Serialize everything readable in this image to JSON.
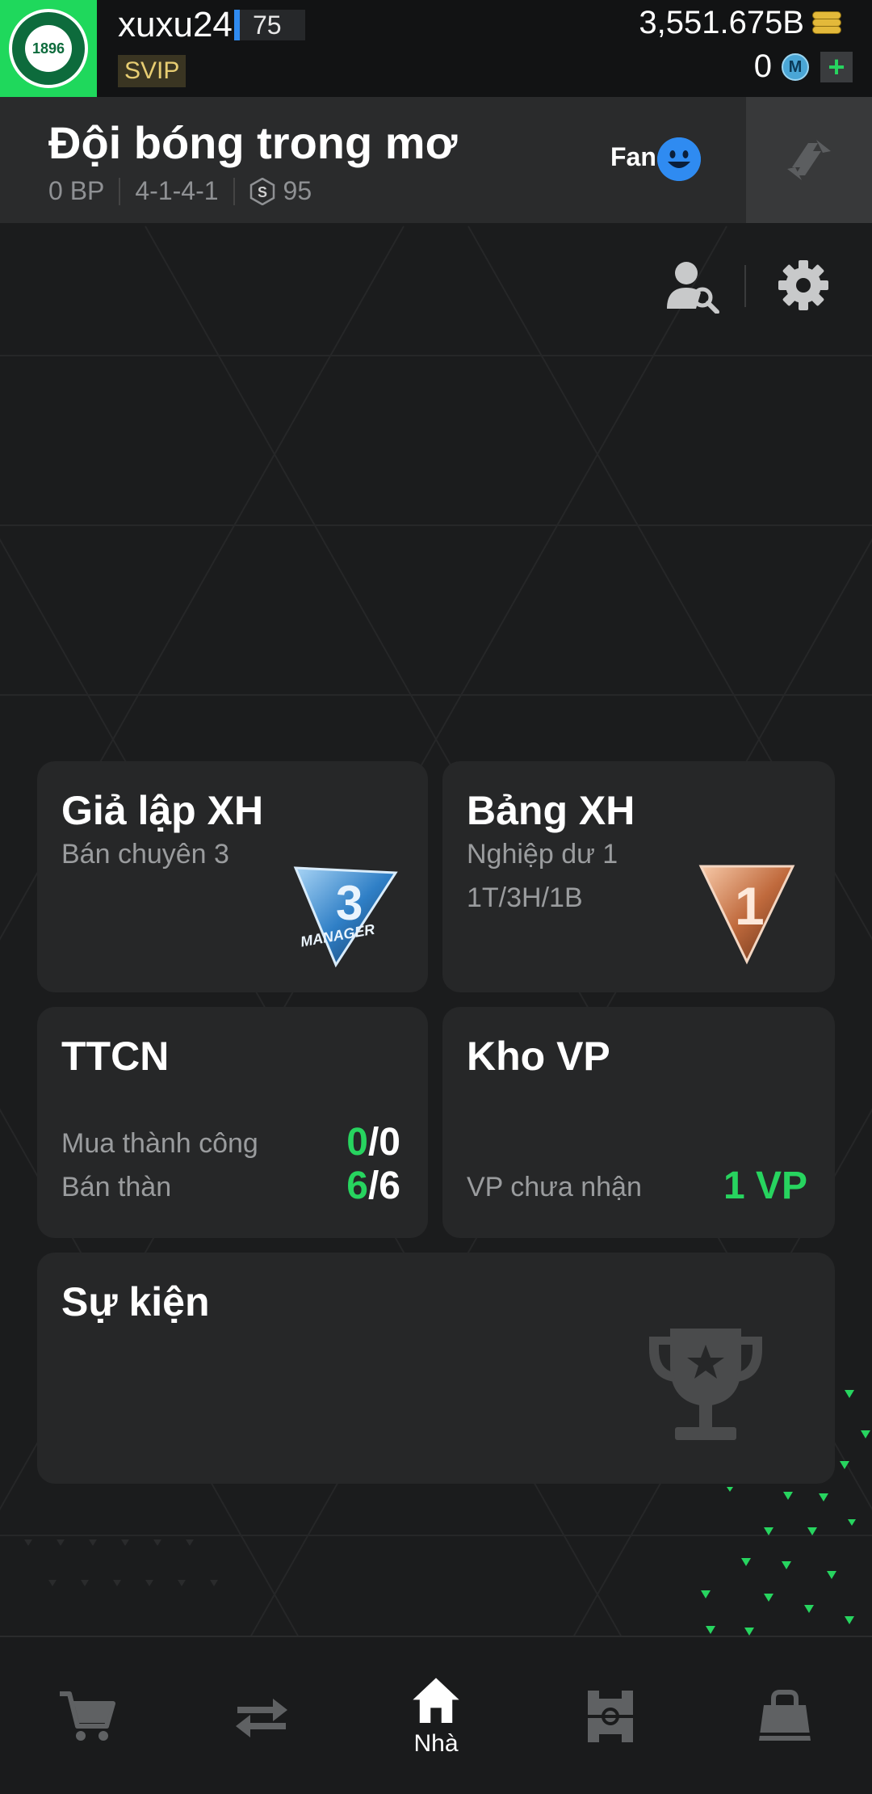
{
  "topbar": {
    "username": "xuxu24",
    "level": "75",
    "vip": "SVIP",
    "coins": "3,551.675B",
    "m_coins": "0",
    "add_symbol": "+",
    "m_coin_letter": "M",
    "club_logo_text": "1896"
  },
  "team": {
    "name": "Đội bóng trong mơ",
    "bp": "0 BP",
    "formation": "4-1-4-1",
    "s_value": "95",
    "s_icon_letter": "S",
    "fan_label": "Fan"
  },
  "cards": {
    "sim": {
      "title": "Giả lập XH",
      "sub": "Bán chuyên 3",
      "badge": "3",
      "badge_text": "MANAGER"
    },
    "rank": {
      "title": "Bảng XH",
      "sub": "Nghiệp dư 1",
      "record": "1T/3H/1B",
      "badge": "1"
    },
    "ttcn": {
      "title": "TTCN",
      "buy_label": "Mua thành công",
      "buy_done": "0",
      "buy_total": "/0",
      "sell_label": "Bán thàn",
      "sell_done": "6",
      "sell_total": "/6"
    },
    "kho": {
      "title": "Kho VP",
      "label": "VP chưa nhận",
      "value": "1 VP"
    },
    "event": {
      "title": "Sự kiện"
    }
  },
  "nav": {
    "items": [
      {
        "icon": "cart-icon"
      },
      {
        "icon": "transfer-icon"
      },
      {
        "icon": "home-icon",
        "label": "Nhà",
        "active": true
      },
      {
        "icon": "pitch-icon"
      },
      {
        "icon": "bag-icon"
      }
    ]
  },
  "colors": {
    "accent_green": "#27d45f",
    "blue": "#2f8bf1",
    "gold": "#e7cd72",
    "background": "#1b1c1d",
    "card": "#262728"
  }
}
